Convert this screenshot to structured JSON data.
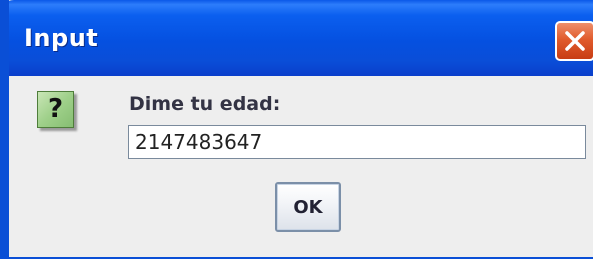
{
  "window": {
    "title": "Input"
  },
  "dialog": {
    "icon_name": "question-icon",
    "icon_glyph": "?",
    "prompt": "Dime tu edad:",
    "input_value": "2147483647",
    "ok_label": "OK"
  },
  "colors": {
    "titlebar": "#0550e0",
    "close_button": "#e15b2c",
    "icon_background": "#9fd08a",
    "dialog_background": "#eeeeee"
  }
}
